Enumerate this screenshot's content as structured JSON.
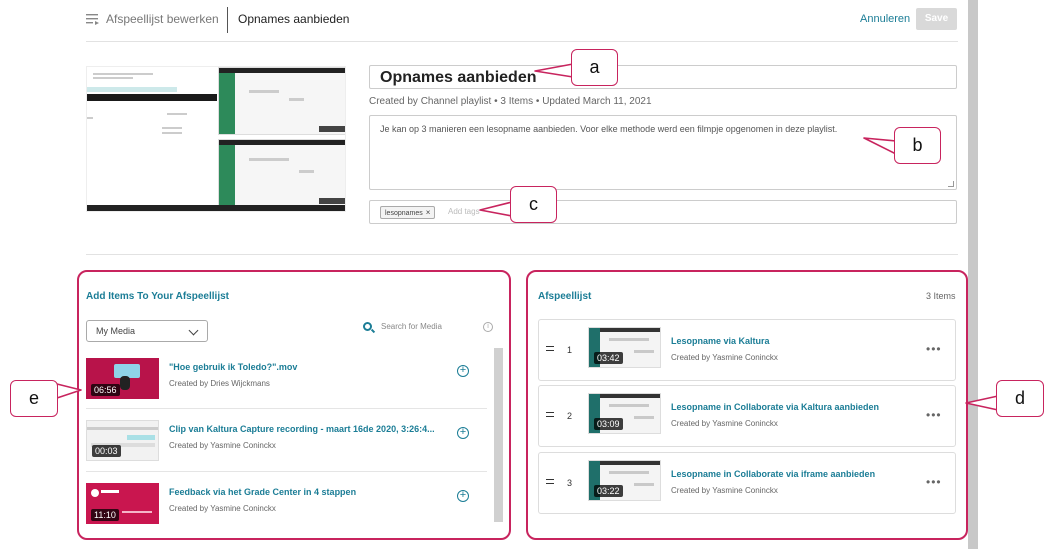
{
  "topbar": {
    "edit_label": "Afspeellijst bewerken",
    "page_title": "Opnames aanbieden",
    "cancel": "Annuleren",
    "save": "Save"
  },
  "details": {
    "title": "Opnames aanbieden",
    "meta": "Created by Channel playlist • 3 Items • Updated March 11, 2021",
    "description": "Je kan op 3 manieren een lesopname aanbieden. Voor elke methode werd een filmpje opgenomen in deze playlist.",
    "tags": [
      "lesopnames"
    ],
    "tags_placeholder": "Add tags"
  },
  "add_panel": {
    "title": "Add Items To Your Afspeellijst",
    "source_select": "My Media",
    "search_placeholder": "Search for Media",
    "items": [
      {
        "title": "\"Hoe gebruik ik Toledo?\".mov",
        "creator": "Created by Dries Wijckmans",
        "duration": "06:56"
      },
      {
        "title": "Clip van Kaltura Capture recording - maart 16de 2020, 3:26:4...",
        "creator": "Created by Yasmine Coninckx",
        "duration": "00:03"
      },
      {
        "title": "Feedback via het Grade Center in 4 stappen",
        "creator": "Created by Yasmine Coninckx",
        "duration": "11:10"
      }
    ]
  },
  "playlist": {
    "title": "Afspeellijst",
    "count": "3 Items",
    "items": [
      {
        "num": "1",
        "title": "Lesopname via Kaltura",
        "creator": "Created by Yasmine Coninckx",
        "duration": "03:42"
      },
      {
        "num": "2",
        "title": "Lesopname in Collaborate via Kaltura aanbieden",
        "creator": "Created by Yasmine Coninckx",
        "duration": "03:09"
      },
      {
        "num": "3",
        "title": "Lesopname in Collaborate via iframe aanbieden",
        "creator": "Created by Yasmine Coninckx",
        "duration": "03:22"
      }
    ]
  },
  "callouts": {
    "a": "a",
    "b": "b",
    "c": "c",
    "d": "d",
    "e": "e"
  },
  "colors": {
    "accent": "#1b7d96",
    "callout": "#c8245e"
  }
}
